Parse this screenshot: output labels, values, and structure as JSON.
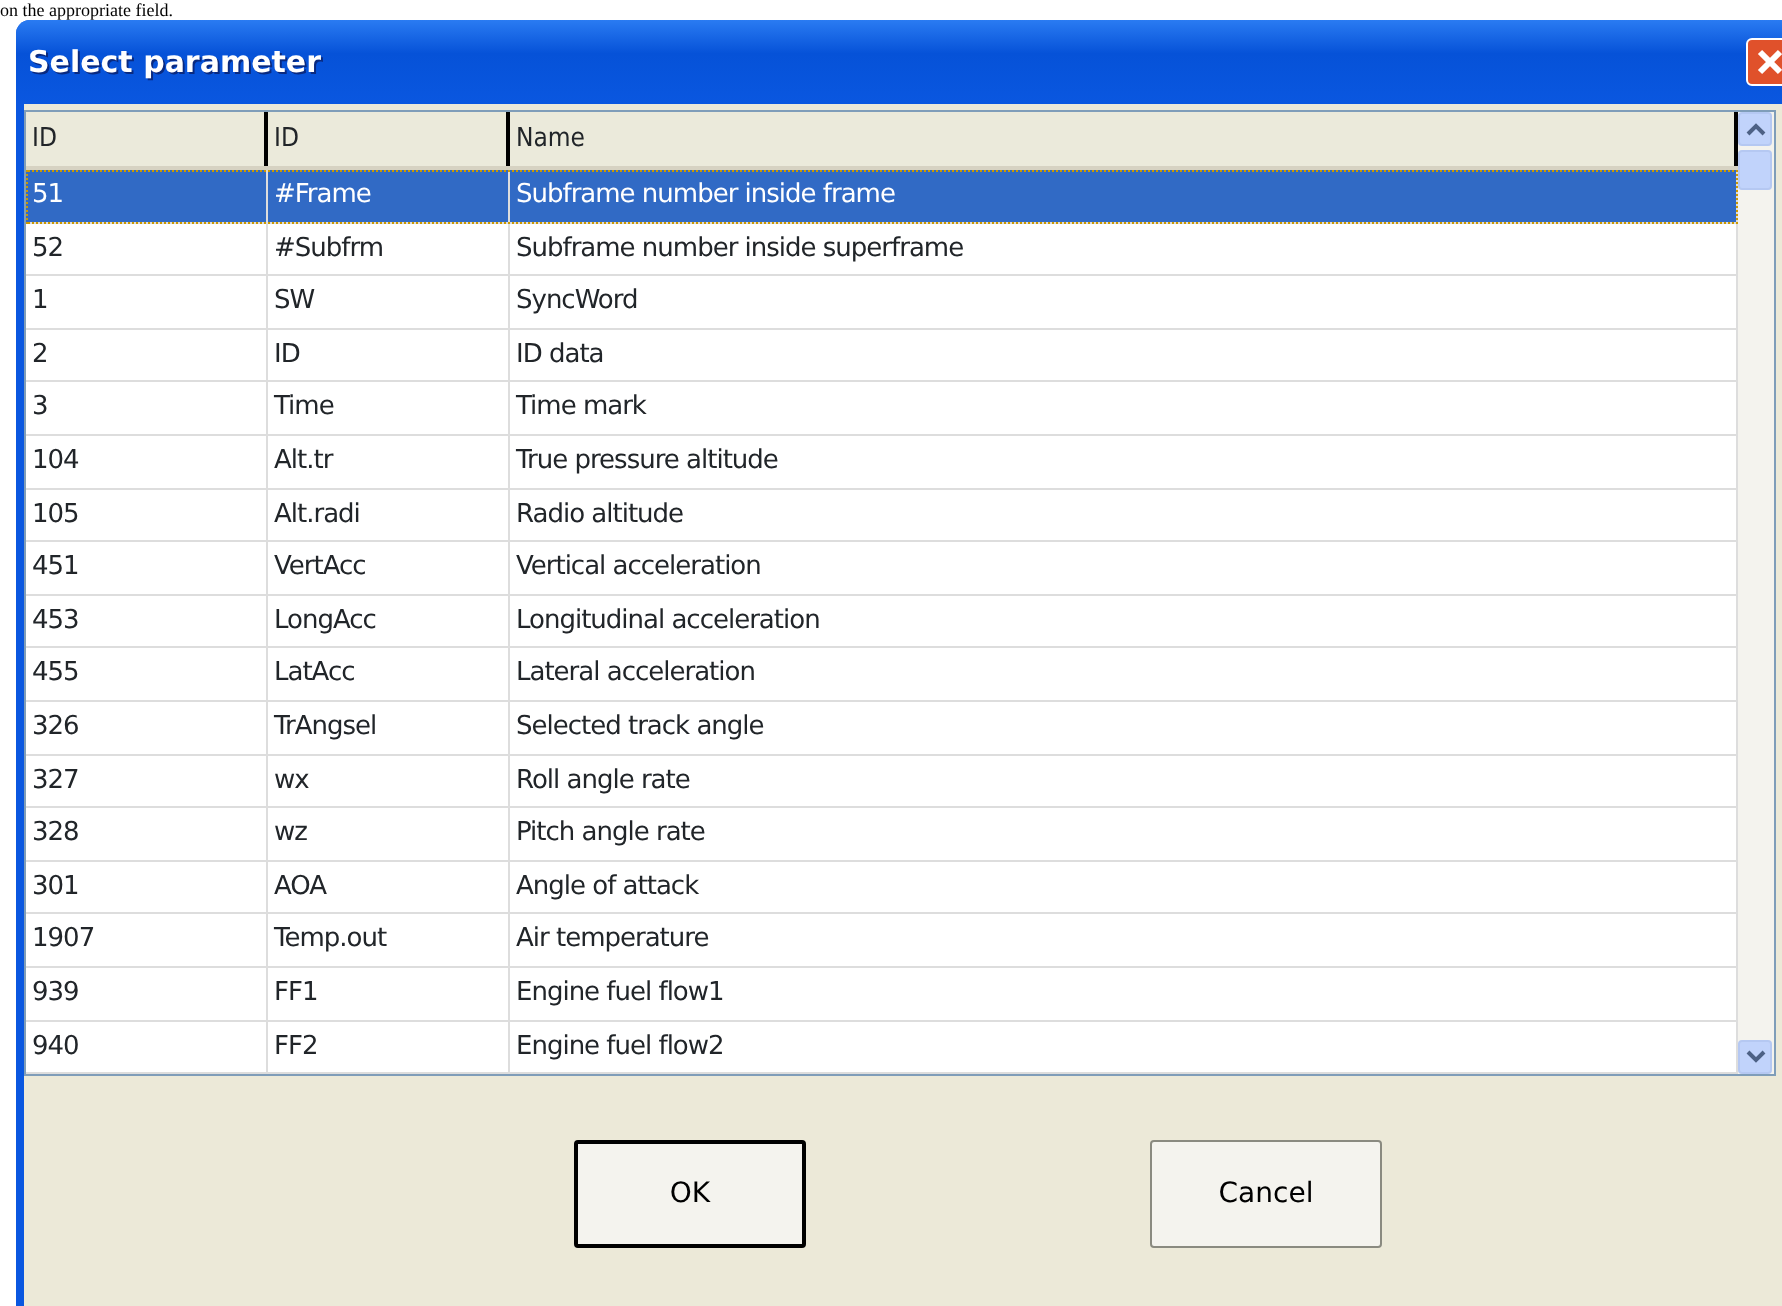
{
  "page_text": "on the appropriate field.",
  "window": {
    "title": "Select parameter"
  },
  "table": {
    "columns": [
      "ID",
      "ID",
      "Name"
    ],
    "rows": [
      {
        "cells": [
          "51",
          "#Frame",
          "Subframe number inside frame"
        ],
        "selected": true
      },
      {
        "cells": [
          "52",
          "#Subfrm",
          "Subframe number inside superframe"
        ],
        "selected": false
      },
      {
        "cells": [
          "1",
          "SW",
          "SyncWord"
        ],
        "selected": false
      },
      {
        "cells": [
          "2",
          "ID",
          "ID data"
        ],
        "selected": false
      },
      {
        "cells": [
          "3",
          "Time",
          "Time mark"
        ],
        "selected": false
      },
      {
        "cells": [
          "104",
          "Alt.tr",
          "True pressure altitude"
        ],
        "selected": false
      },
      {
        "cells": [
          "105",
          "Alt.radi",
          "Radio altitude"
        ],
        "selected": false
      },
      {
        "cells": [
          "451",
          "VertAcc",
          "Vertical acceleration"
        ],
        "selected": false
      },
      {
        "cells": [
          "453",
          "LongAcc",
          "Longitudinal acceleration"
        ],
        "selected": false
      },
      {
        "cells": [
          "455",
          "LatAcc",
          "Lateral acceleration"
        ],
        "selected": false
      },
      {
        "cells": [
          "326",
          "TrAngsel",
          "Selected track angle"
        ],
        "selected": false
      },
      {
        "cells": [
          "327",
          "wx",
          "Roll angle rate"
        ],
        "selected": false
      },
      {
        "cells": [
          "328",
          "wz",
          "Pitch angle rate"
        ],
        "selected": false
      },
      {
        "cells": [
          "301",
          "AOA",
          "Angle of attack"
        ],
        "selected": false
      },
      {
        "cells": [
          "1907",
          "Temp.out",
          "Air temperature"
        ],
        "selected": false
      },
      {
        "cells": [
          "939",
          "FF1",
          "Engine fuel flow1"
        ],
        "selected": false
      },
      {
        "cells": [
          "940",
          "FF2",
          "Engine fuel flow2"
        ],
        "selected": false
      }
    ]
  },
  "buttons": [
    {
      "label": "OK",
      "default": true
    },
    {
      "label": "Cancel",
      "default": false
    }
  ]
}
